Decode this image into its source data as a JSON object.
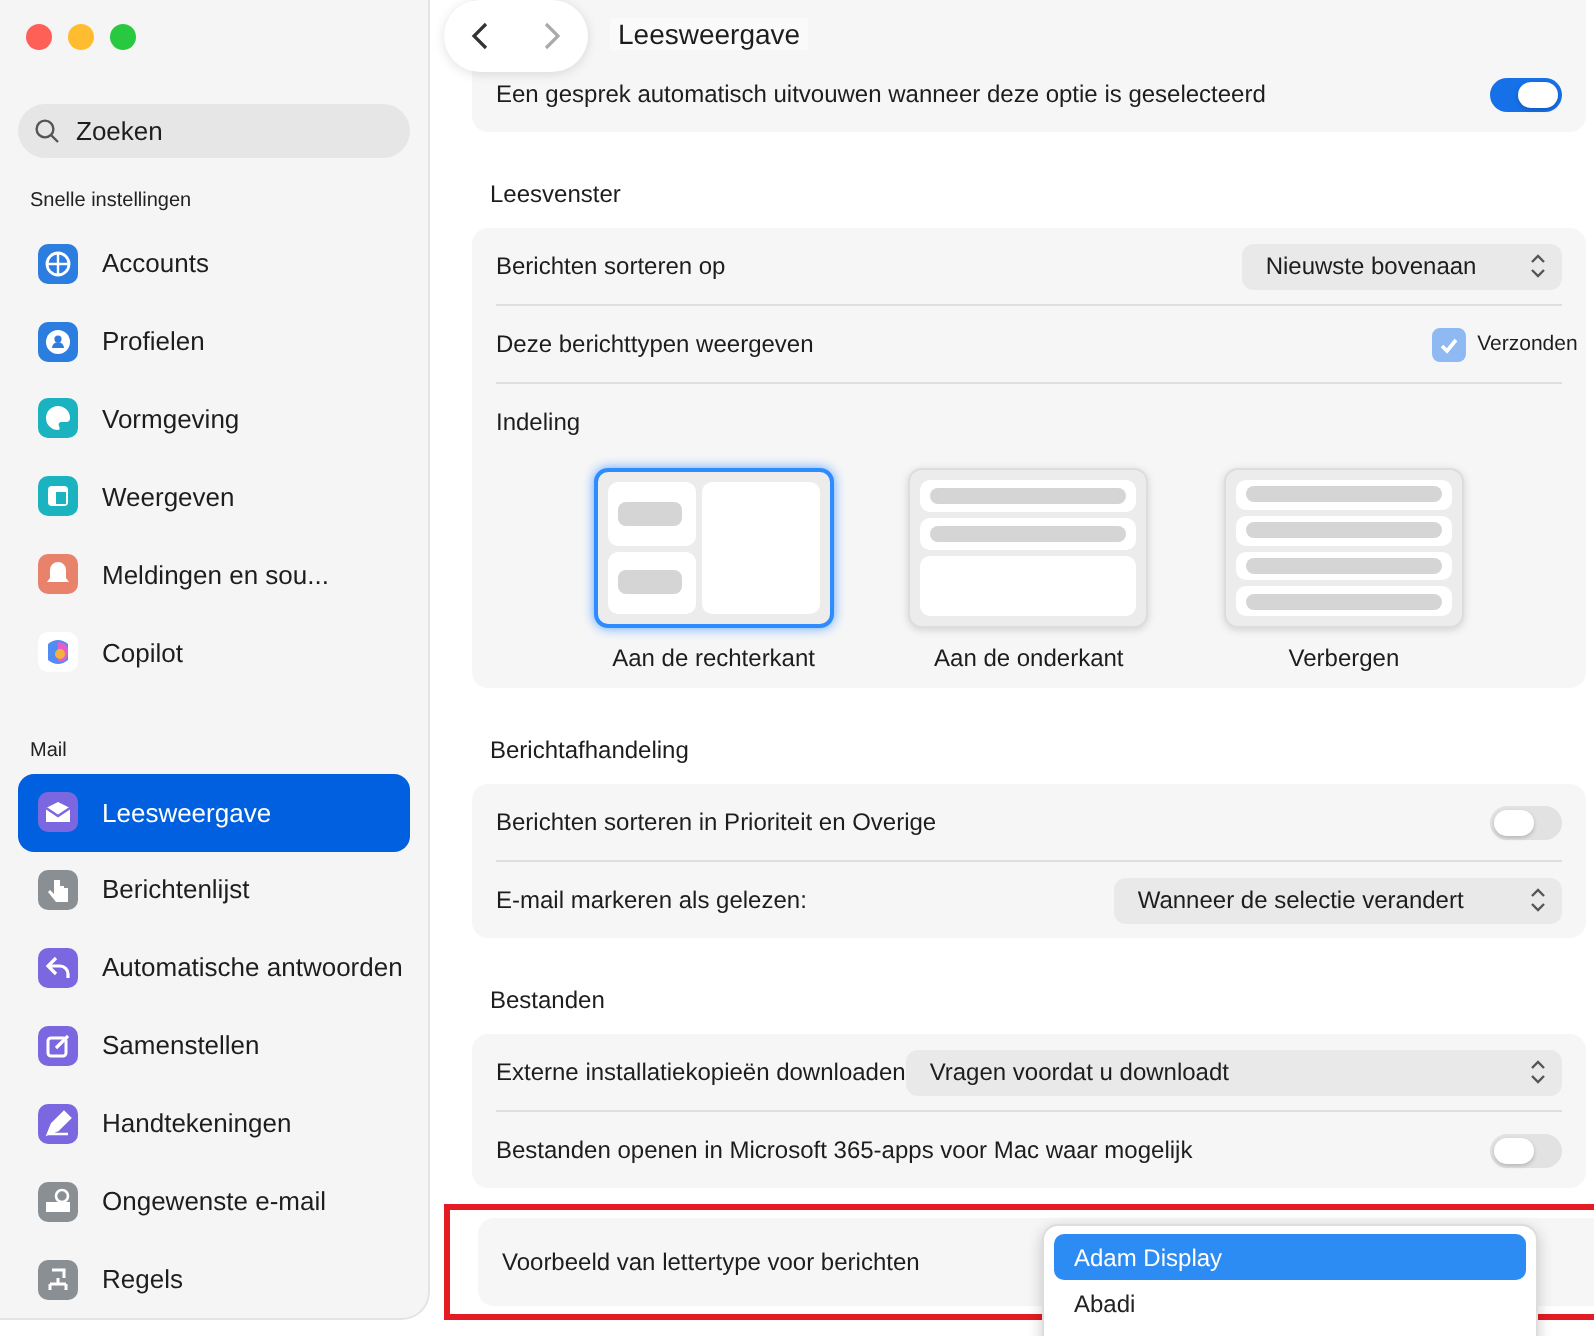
{
  "window": {
    "title": "Leesweergave"
  },
  "sidebar": {
    "search": {
      "placeholder": "Zoeken"
    },
    "sections": [
      {
        "title": "Snelle instellingen",
        "items": [
          {
            "label": "Accounts",
            "color": "#2b7de0",
            "selected": false
          },
          {
            "label": "Profielen",
            "color": "#2b7de0",
            "selected": false
          },
          {
            "label": "Vormgeving",
            "color": "#1cb3c0",
            "selected": false
          },
          {
            "label": "Weergeven",
            "color": "#1cb3c0",
            "selected": false
          },
          {
            "label": "Meldingen en sou...",
            "color": "#e9826a",
            "selected": false
          },
          {
            "label": "Copilot",
            "color": "#ffffff",
            "selected": false
          }
        ]
      },
      {
        "title": "Mail",
        "items": [
          {
            "label": "Leesweergave",
            "color": "#7b68e0",
            "selected": true
          },
          {
            "label": "Berichtenlijst",
            "color": "#8a8f94",
            "selected": false
          },
          {
            "label": "Automatische antwoorden",
            "color": "#7b68e0",
            "selected": false
          },
          {
            "label": "Samenstellen",
            "color": "#7b68e0",
            "selected": false
          },
          {
            "label": "Handtekeningen",
            "color": "#7b68e0",
            "selected": false
          },
          {
            "label": "Ongewenste e-mail",
            "color": "#8a8f94",
            "selected": false
          },
          {
            "label": "Regels",
            "color": "#8a8f94",
            "selected": false
          }
        ]
      }
    ]
  },
  "top_card": {
    "rows": [
      {
        "kind": "toggle",
        "label": "Een gesprek automatisch uitvouwen wanneer deze optie is geselecteerd",
        "on": true
      }
    ]
  },
  "sections": [
    {
      "title": "Leesvenster",
      "rows": [
        {
          "kind": "select",
          "label": "Berichten sorteren op",
          "value": "Nieuwste bovenaan"
        },
        {
          "kind": "checkbox",
          "label": "Deze berichttypen weergeven",
          "option": "Verzonden",
          "checked": true
        },
        {
          "kind": "layout",
          "label": "Indeling",
          "options": [
            {
              "label": "Aan de rechterkant",
              "selected": true
            },
            {
              "label": "Aan de onderkant",
              "selected": false
            },
            {
              "label": "Verbergen",
              "selected": false
            }
          ]
        }
      ]
    },
    {
      "title": "Berichtafhandeling",
      "rows": [
        {
          "kind": "toggle",
          "label": "Berichten sorteren in Prioriteit en Overige",
          "on": false
        },
        {
          "kind": "select",
          "label": "E-mail markeren als gelezen:",
          "value": "Wanneer de selectie verandert"
        }
      ]
    },
    {
      "title": "Bestanden",
      "rows": [
        {
          "kind": "wideselect",
          "label": "Externe installatiekopieën downloaden",
          "value": "Vragen voordat u downloadt"
        },
        {
          "kind": "toggle",
          "label": "Bestanden openen in Microsoft 365-apps voor Mac waar mogelijk",
          "on": false
        }
      ]
    }
  ],
  "font_preview": {
    "label": "Voorbeeld van lettertype voor berichten",
    "highlighted": true,
    "options": [
      {
        "label": "Adam Display",
        "selected": true
      },
      {
        "label": "Abadi",
        "selected": false
      }
    ]
  }
}
